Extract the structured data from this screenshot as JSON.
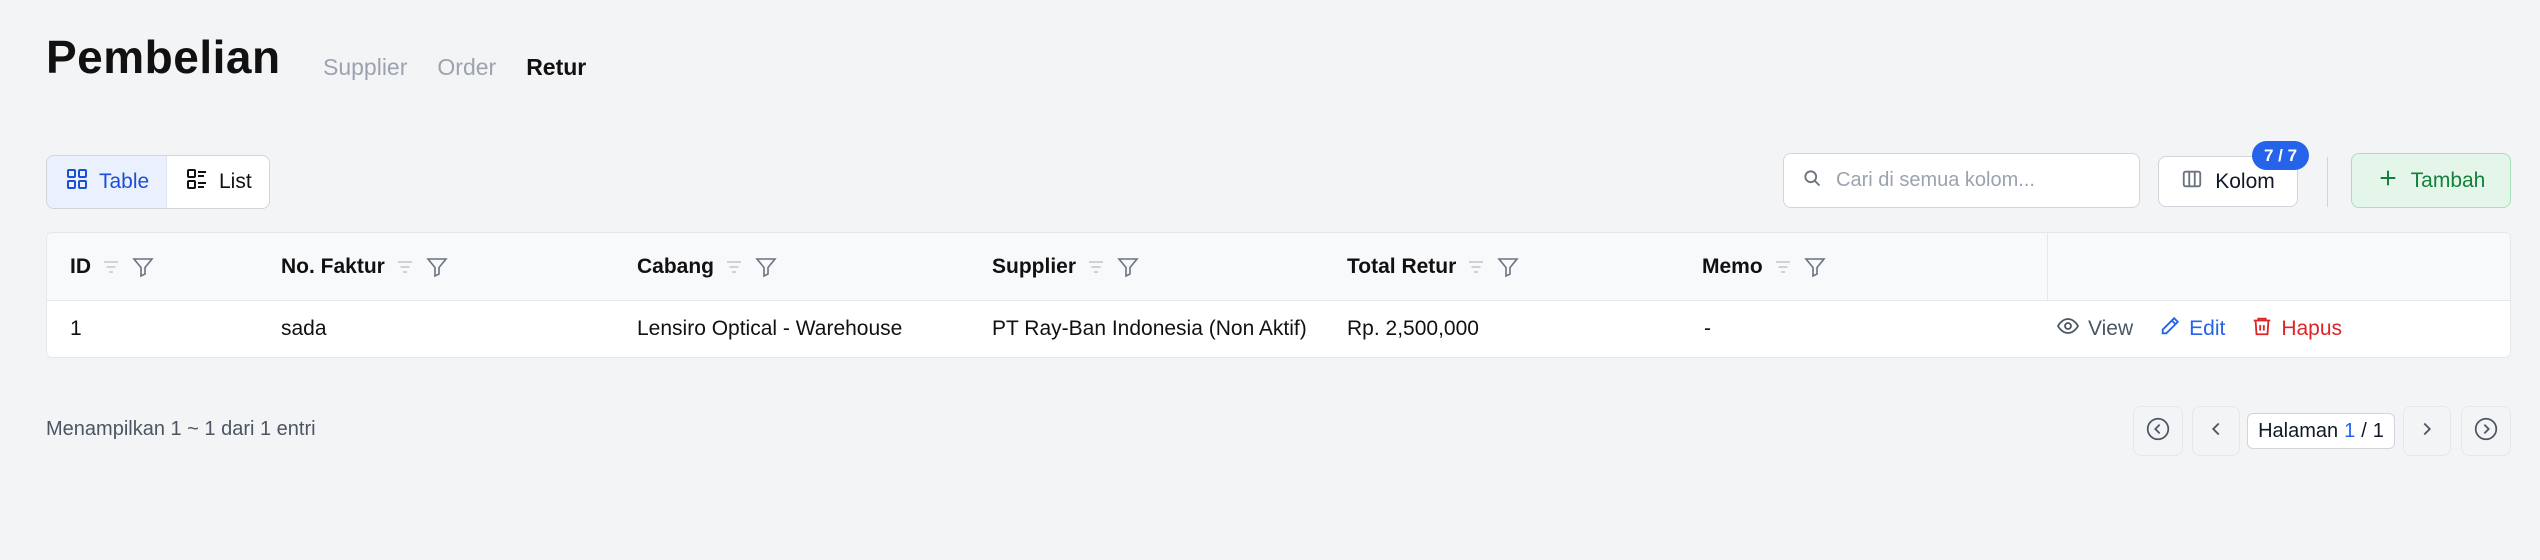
{
  "header": {
    "title": "Pembelian",
    "tabs": [
      {
        "label": "Supplier",
        "active": false
      },
      {
        "label": "Order",
        "active": false
      },
      {
        "label": "Retur",
        "active": true
      }
    ]
  },
  "toolbar": {
    "view_table_label": "Table",
    "view_list_label": "List",
    "search_placeholder": "Cari di semua kolom...",
    "kolom_label": "Kolom",
    "kolom_badge": "7 / 7",
    "add_label": "Tambah"
  },
  "table": {
    "columns": [
      "ID",
      "No. Faktur",
      "Cabang",
      "Supplier",
      "Total Retur",
      "Memo"
    ],
    "rows": [
      {
        "cells": [
          "1",
          "sada",
          "Lensiro Optical - Warehouse",
          "PT Ray-Ban Indonesia (Non Aktif)",
          "Rp. 2,500,000",
          "-"
        ],
        "actions": {
          "view": "View",
          "edit": "Edit",
          "delete": "Hapus"
        }
      }
    ]
  },
  "footer": {
    "info": "Menampilkan 1 ~ 1 dari 1 entri",
    "page_label": "Halaman",
    "current_page": "1",
    "page_sep": "/",
    "total_pages": "1"
  },
  "colors": {
    "accent": "#2563eb",
    "success": "#15803d",
    "danger": "#dc2626",
    "background": "#f3f4f6"
  }
}
